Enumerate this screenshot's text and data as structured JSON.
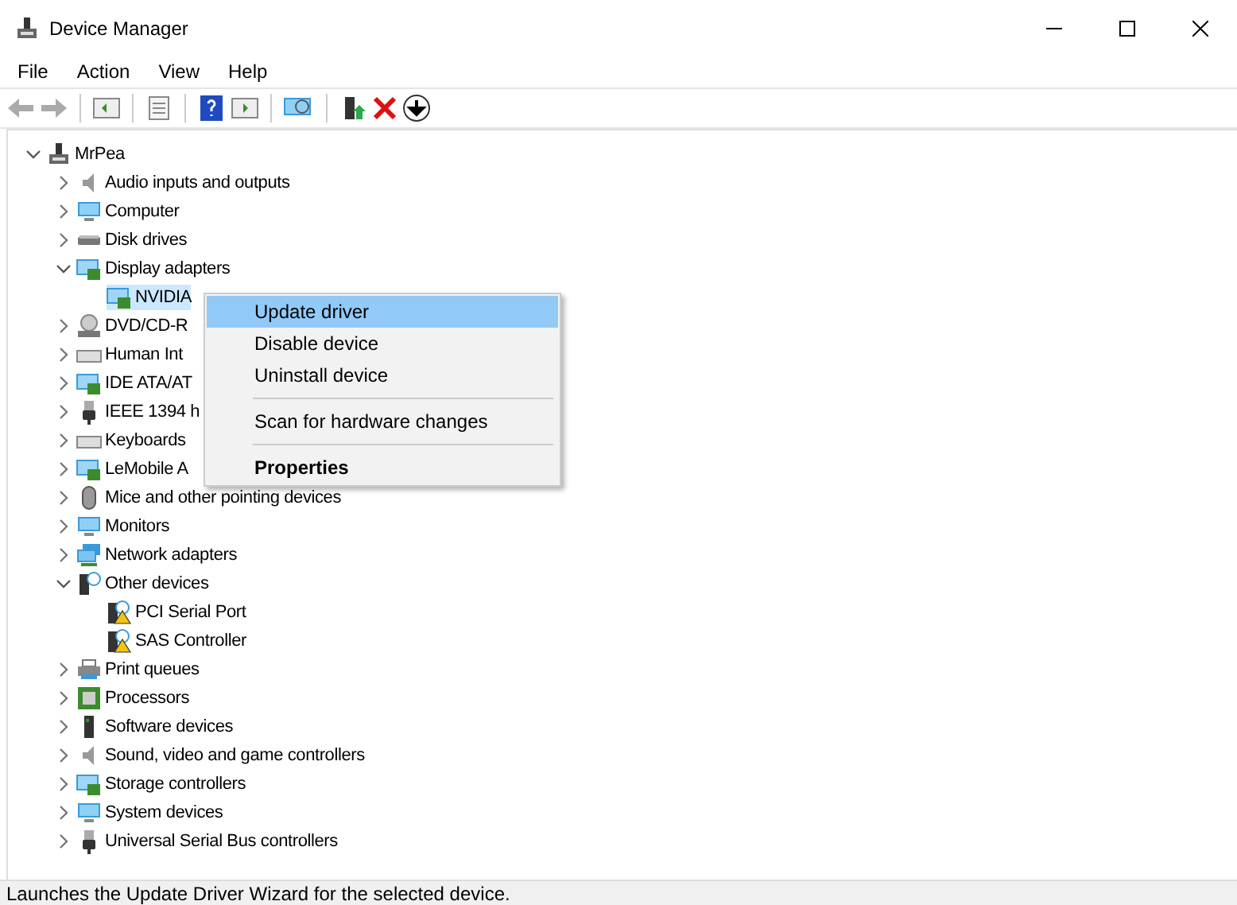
{
  "window": {
    "title": "Device Manager"
  },
  "menu_bar": [
    "File",
    "Action",
    "View",
    "Help"
  ],
  "tree": {
    "label": "MrPea",
    "expanded": true,
    "selected": false,
    "kind": "computer",
    "children": [
      {
        "label": "Audio inputs and outputs",
        "kind": "speaker",
        "expanded": false,
        "selected": false
      },
      {
        "label": "Computer",
        "kind": "monitor",
        "expanded": false,
        "selected": false
      },
      {
        "label": "Disk drives",
        "kind": "disk",
        "expanded": false,
        "selected": false
      },
      {
        "label": "Display adapters",
        "kind": "card",
        "expanded": true,
        "selected": false,
        "children": [
          {
            "label": "NVIDIA",
            "kind": "card",
            "selected": true
          }
        ]
      },
      {
        "label": "DVD/CD-R",
        "kind": "disc",
        "expanded": false,
        "selected": false
      },
      {
        "label": "Human Int",
        "kind": "keyboard",
        "expanded": false,
        "selected": false
      },
      {
        "label": "IDE ATA/AT",
        "kind": "card",
        "expanded": false,
        "selected": false
      },
      {
        "label": "IEEE 1394 h",
        "kind": "usb",
        "expanded": false,
        "selected": false
      },
      {
        "label": "Keyboards",
        "kind": "keyboard",
        "expanded": false,
        "selected": false
      },
      {
        "label": "LeMobile A",
        "kind": "card",
        "expanded": false,
        "selected": false
      },
      {
        "label": "Mice and other pointing devices",
        "kind": "mouse",
        "expanded": false,
        "selected": false
      },
      {
        "label": "Monitors",
        "kind": "monitor",
        "expanded": false,
        "selected": false
      },
      {
        "label": "Network adapters",
        "kind": "network",
        "expanded": false,
        "selected": false
      },
      {
        "label": "Other devices",
        "kind": "unknown",
        "expanded": true,
        "selected": false,
        "children": [
          {
            "label": "PCI Serial Port",
            "kind": "warning",
            "selected": false
          },
          {
            "label": "SAS Controller",
            "kind": "warning",
            "selected": false
          }
        ]
      },
      {
        "label": "Print queues",
        "kind": "printer",
        "expanded": false,
        "selected": false
      },
      {
        "label": "Processors",
        "kind": "chip",
        "expanded": false,
        "selected": false
      },
      {
        "label": "Software devices",
        "kind": "tower",
        "expanded": false,
        "selected": false
      },
      {
        "label": "Sound, video and game controllers",
        "kind": "speaker",
        "expanded": false,
        "selected": false
      },
      {
        "label": "Storage controllers",
        "kind": "card",
        "expanded": false,
        "selected": false
      },
      {
        "label": "System devices",
        "kind": "monitor",
        "expanded": false,
        "selected": false
      },
      {
        "label": "Universal Serial Bus controllers",
        "kind": "usb",
        "expanded": false,
        "selected": false
      }
    ]
  },
  "context_menu": [
    {
      "kind": "item",
      "label": "Update driver",
      "selected": true,
      "bold": false
    },
    {
      "kind": "item",
      "label": "Disable device",
      "selected": false,
      "bold": false
    },
    {
      "kind": "item",
      "label": "Uninstall device",
      "selected": false,
      "bold": false
    },
    {
      "kind": "separator"
    },
    {
      "kind": "item",
      "label": "Scan for hardware changes",
      "selected": false,
      "bold": false
    },
    {
      "kind": "separator"
    },
    {
      "kind": "item",
      "label": "Properties",
      "selected": false,
      "bold": true
    }
  ],
  "status_bar": "Launches the Update Driver Wizard for the selected device."
}
